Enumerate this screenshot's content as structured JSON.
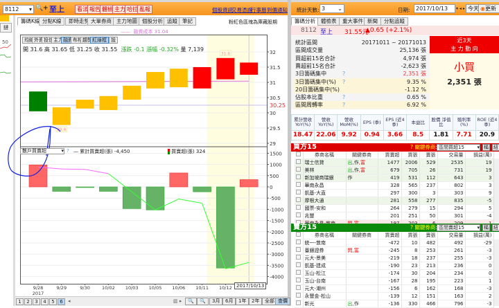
{
  "toolbar": {
    "stock_code": "8112",
    "stock_name": "至上",
    "buttons": [
      "看法",
      "報告",
      "體檢",
      "主力",
      "哈拉",
      "亂報"
    ],
    "links": [
      "個股資訊",
      "交易憑證",
      "行事曆",
      "到價通知"
    ],
    "stat_days_label": "統計天數:",
    "stat_days_value": "3",
    "date_label": "日期:",
    "date_value": "2017/10/13",
    "today_label": "今天",
    "refresh_label": "更新"
  },
  "left_tabs": [
    "籌碼K線",
    "分點K線",
    "即時走勢",
    "大單券商",
    "主力地圖",
    "個股分析",
    "追蹤",
    "筆記"
  ],
  "left_note": "粉紅色區塊為庫藏股期",
  "sidebar": {
    "button": "鏈",
    "label": "50"
  },
  "chart_buttons": [
    "均線",
    "外資",
    "投信",
    "主力",
    "融資",
    "布林",
    "趨勢",
    "紅綠框",
    "?",
    "設"
  ],
  "quote": {
    "open": "開 31.6",
    "high": "高 31.65",
    "low": "低 31.25",
    "close": "收 31.55",
    "change": "漲跌 -0.1",
    "pct": "漲幅 -0.32%",
    "volume": "量 7,139"
  },
  "lower_select": "散戶買賣超",
  "lower_legend": {
    "q": "?",
    "cum": "累計買賣超(張) -4,450",
    "net": "買賣超(張) 324"
  },
  "pager": {
    "pages": [
      "1",
      "2",
      "3",
      "4",
      "5",
      "6"
    ],
    "active": "6",
    "zoom": [
      "3月",
      "6月",
      "1年",
      "2年",
      "全部",
      "查價"
    ]
  },
  "chart_data": [
    {
      "type": "bar",
      "subtype": "high-low boxes",
      "legend": "融資成本 31.04",
      "margin_cost": 31.04,
      "marker_line": 30.25,
      "categories": [
        "9/28",
        "9/29",
        "9/30",
        "10/02",
        "10/03",
        "10/05",
        "10/06",
        "10/11",
        "10/12",
        "10/13"
      ],
      "year_label": "2017",
      "selected_label": "2017/10/13",
      "highlight_dates": [
        "10/12",
        "10/13"
      ],
      "high": [
        30.7,
        30.18,
        30.43,
        30.55,
        30.89,
        31.34,
        31.45,
        31.5,
        31.8,
        31.65
      ],
      "low": [
        30.05,
        29.6,
        30.14,
        30.09,
        30.43,
        30.8,
        30.84,
        30.8,
        31.1,
        31.25
      ],
      "colors": [
        "#008000",
        "#FFC000",
        "#FFC000",
        "#FFC000",
        "#FFC000",
        "#FFC000",
        "#FFC000",
        "#FF0000",
        "#FF0000",
        "#FF0000"
      ],
      "annotations": [
        {
          "date": "9/29",
          "text": "29.6"
        },
        {
          "date": "10/12",
          "text": "31.8"
        }
      ],
      "yticks": [
        "32",
        "31.5",
        "31",
        "30.5",
        "30",
        "29.5",
        "29"
      ],
      "ylim": [
        29,
        32
      ],
      "marker_label": "30.25",
      "grid": true
    },
    {
      "type": "bar",
      "categories": [
        "9/28",
        "9/29",
        "9/30",
        "10/02",
        "10/03",
        "10/05",
        "10/06",
        "10/11",
        "10/12",
        "10/13"
      ],
      "series": [
        {
          "name": "買賣超(張)",
          "values": [
            980,
            -200,
            -20,
            -200,
            -970,
            -1030,
            620,
            -220,
            -3620,
            324
          ]
        },
        {
          "name": "累計買賣超(張)",
          "type": "line",
          "values": [
            880,
            800,
            780,
            590,
            -220,
            -1030,
            -540,
            -730,
            -3650,
            -3370
          ]
        }
      ],
      "yticks": [
        "1500",
        "1000",
        "500",
        "0",
        "-500",
        "-1000",
        "-1500",
        "-2000",
        "-2500",
        "-3000",
        "-3500",
        "-4000"
      ],
      "ylim": [
        -4100,
        1600
      ],
      "grid": true,
      "colors": {
        "pos": "#FF6666",
        "neg": "#66B266",
        "cum_pos": "#FF66FF",
        "cum_neg": "#33FF33"
      }
    }
  ],
  "right_tabs": [
    "籌碼分析",
    "體檢表",
    "重大事件",
    "新聞",
    "分點追蹤"
  ],
  "stock_line": {
    "code": "8112",
    "name": "至上",
    "price": "31.55元",
    "change": "▲0.65 (+2.1%)"
  },
  "stats": [
    {
      "label": "統計區間",
      "value": "20171011 ~ 20171013"
    },
    {
      "label": "區間成交量",
      "value": "25,136 張"
    },
    {
      "label": "買超前15名合計",
      "value": "4,974 張"
    },
    {
      "label": "賣超前15名合計",
      "value": "-2,623 張"
    },
    {
      "label": "3日籌碼集中",
      "q": "?",
      "value": "2,351 張",
      "red": true
    },
    {
      "label": "3日籌碼集中(%)",
      "q": "?",
      "value": "9.35 %",
      "hl": true
    },
    {
      "label": "20日籌碼集中(%)",
      "value": "-1.12 %",
      "hl": true
    },
    {
      "label": "佔股本比重",
      "q": "?",
      "value": "0.65 %"
    },
    {
      "label": "區間周轉率",
      "q": "?",
      "value": "6.92 %",
      "hl": true
    }
  ],
  "trend_box": {
    "line1": "近3天",
    "line2": "主 力 動 向",
    "verdict": "小買",
    "amount": "2,351 張"
  },
  "fundamentals": {
    "headers": [
      "累計營收 YoY(%)",
      "營收 YoY(%)",
      "營收 MoM(%)",
      "EPS (季)",
      "EPS (近4季)",
      "本益比",
      "股價 淨值比",
      "殖利率 (%)",
      "ROE (近4季)"
    ],
    "values": [
      "18.47",
      "22.06",
      "9.92",
      "0.94",
      "3.66",
      "8.5",
      "1.81",
      "7.71",
      "20.9"
    ]
  },
  "buy_panel": {
    "title": "買方15",
    "key_label": "? 關鍵券商:",
    "select": "區間買超15",
    "btn1": "稱",
    "btn2": "紐",
    "columns": [
      "券商名稱",
      "關鍵券商",
      "買賣超",
      "買張",
      "賣張",
      "交易量",
      "損益(萬)"
    ],
    "rows": [
      [
        "瑞士信貸",
        "出,作,富",
        "1477",
        "2006",
        "529",
        "2535",
        "19"
      ],
      [
        "美林",
        "出,作,富",
        "679",
        "705",
        "26",
        "731",
        "19"
      ],
      [
        "新加坡商瑞銀",
        "作",
        "419",
        "531",
        "112",
        "643",
        "3"
      ],
      [
        "華南永昌",
        "",
        "328",
        "565",
        "237",
        "802",
        "3"
      ],
      [
        "凱基-大直",
        "",
        "297",
        "300",
        "3",
        "303",
        "9"
      ],
      [
        "摩根大通",
        "",
        "281",
        "558",
        "277",
        "835",
        "-5"
      ],
      [
        "國票-安和",
        "",
        "264",
        "279",
        "15",
        "294",
        "5"
      ],
      [
        "兆豐",
        "",
        "201",
        "251",
        "50",
        "301",
        "-4"
      ],
      [
        "華南永昌-敦南",
        "閃,富",
        "197",
        "203",
        "6",
        "209",
        "1"
      ]
    ]
  },
  "sell_panel": {
    "title": "賣方15",
    "key_label": "? 關鍵券商:",
    "select": "區間賣超15",
    "btn1": "稱",
    "btn2": "紐",
    "columns": [
      "券商名稱",
      "關鍵券商",
      "買賣超",
      "買張",
      "賣張",
      "交易量",
      "損益(萬)"
    ],
    "rows": [
      [
        "統一-敦南",
        "",
        "-472",
        "10",
        "482",
        "492",
        "-29"
      ],
      [
        "臺銀證券",
        "閃,富",
        "-245",
        "8",
        "253",
        "261",
        "-3"
      ],
      [
        "元大-景美",
        "",
        "-219",
        "18",
        "237",
        "255",
        "-3"
      ],
      [
        "凱基-建成",
        "",
        "-190",
        "23",
        "213",
        "236",
        "0"
      ],
      [
        "玉山-松江",
        "",
        "-174",
        "30",
        "204",
        "234",
        "0"
      ],
      [
        "玉山-台南",
        "",
        "-167",
        "28",
        "195",
        "223",
        "1"
      ],
      [
        "元大-潮州",
        "",
        "-156",
        "6",
        "162",
        "168",
        "-3"
      ],
      [
        "永豐金-松山",
        "",
        "-139",
        "12",
        "151",
        "163",
        "2"
      ],
      [
        "新光",
        "出,作",
        "-136",
        "330",
        "466",
        "796",
        "-3"
      ]
    ]
  }
}
